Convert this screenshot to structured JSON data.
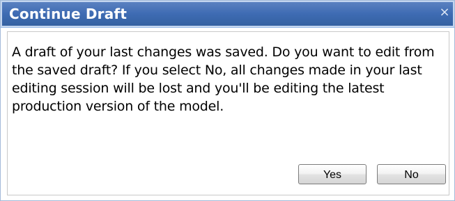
{
  "dialog": {
    "title": "Continue Draft",
    "close_symbol": "×",
    "message": "A draft of your last changes was saved. Do you want to edit from the saved draft? If you select No, all changes made in your last editing session will be lost and you'll be editing the latest production version of the model.",
    "buttons": {
      "yes_label": "Yes",
      "no_label": "No"
    }
  },
  "colors": {
    "titlebar": "#3e6bb3",
    "title_text": "#ffffff",
    "border": "#a3bad9"
  },
  "icons": {
    "close": "close-icon"
  }
}
